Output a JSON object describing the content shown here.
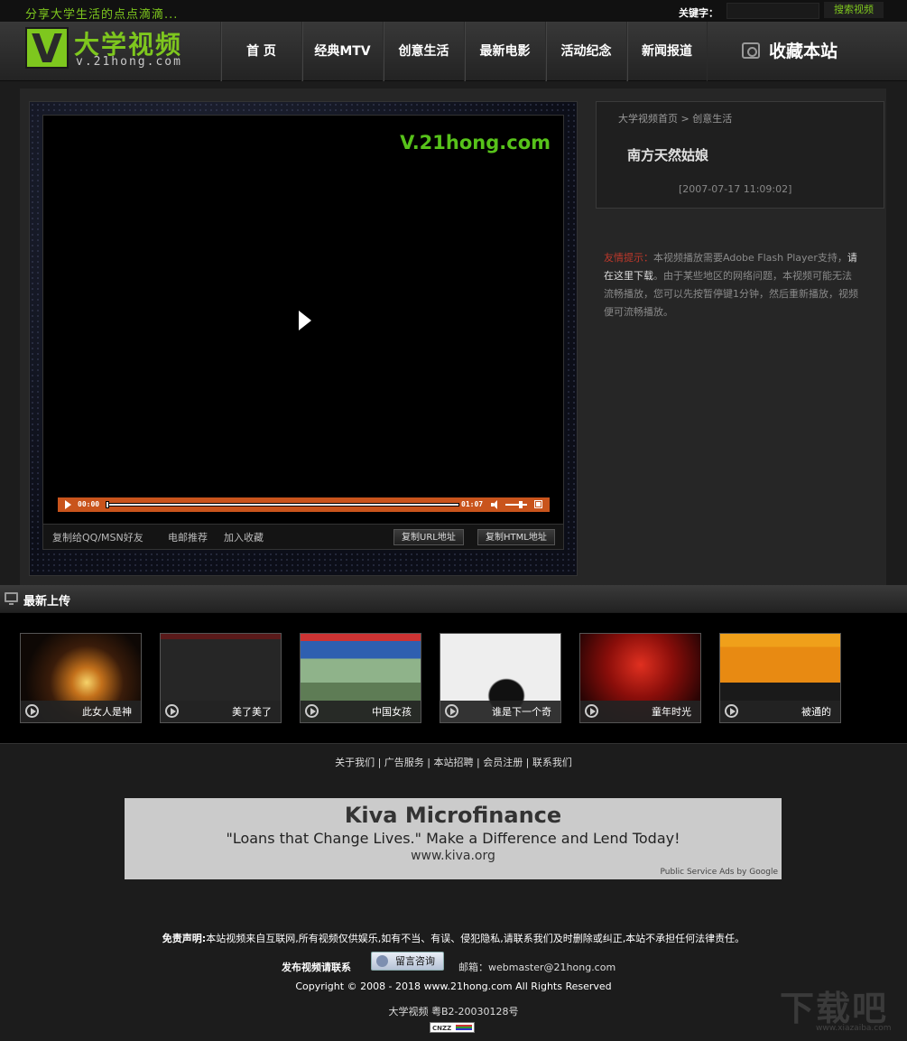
{
  "topbar": {
    "slogan": "分享大学生活的点点滴滴...",
    "keyword_label": "关键字：",
    "search_button": "搜索视频"
  },
  "header": {
    "logo_letter": "V",
    "logo_title": "大学视频",
    "logo_url": "v.21hong.com",
    "nav": [
      "首 页",
      "经典MTV",
      "创意生活",
      "最新电影",
      "活动纪念",
      "新闻报道"
    ],
    "favorite_label": "收藏本站"
  },
  "player": {
    "watermark": "V.21hong.com",
    "time_current": "00:00",
    "time_total": "01:07",
    "progress": 0,
    "volume": 0.7,
    "links": [
      "复制给QQ/MSN好友",
      "电邮推荐",
      "加入收藏"
    ],
    "copy_url_button": "复制URL地址",
    "copy_html_button": "复制HTML地址"
  },
  "info": {
    "breadcrumb_home": "大学视频首页",
    "breadcrumb_sep": ">",
    "breadcrumb_category": "创意生活",
    "title": "南方天然姑娘",
    "date": "[2007-07-17 11:09:02]",
    "tip_label": "友情提示：",
    "tip_part1": "本视频播放需要Adobe Flash Player支持，",
    "tip_link": "请在这里下载",
    "tip_part2": "。由于某些地区的网络问题，本视频可能无法流畅播放，您可以先按暂停键1分钟，然后重新播放，视频便可流畅播放。"
  },
  "latest": {
    "title": "最新上传",
    "items": [
      {
        "label": "此女人是神"
      },
      {
        "label": "美了美了"
      },
      {
        "label": "中国女孩"
      },
      {
        "label": "谁是下一个奇"
      },
      {
        "label": "童年时光"
      },
      {
        "label": "被通的"
      }
    ]
  },
  "footer": {
    "links": "关于我们 | 广告服务 | 本站招聘 | 会员注册 | 联系我们",
    "ad_title": "Kiva Microfinance",
    "ad_tagline": "\"Loans that Change Lives.\" Make a Difference and Lend Today!",
    "ad_url": "www.kiva.org",
    "ad_by": "Public Service Ads by Google",
    "disclaimer_label": "免责声明:",
    "disclaimer_text": "本站视频来自互联网,所有视频仅供娱乐,如有不当、有误、侵犯隐私,请联系我们及时删除或纠正,本站不承担任何法律责任。",
    "publish_label": "发布视频请联系",
    "message_button": "留言咨询",
    "email": "邮箱：webmaster@21hong.com",
    "copyright": "Copyright © 2008 - 2018 www.21hong.com All Rights Reserved",
    "icp": "大学视频 粤B2-20030128号",
    "cnzz": "CNZZ",
    "site_mark": "下载吧",
    "site_mark_url": "www.xiazaiba.com"
  }
}
